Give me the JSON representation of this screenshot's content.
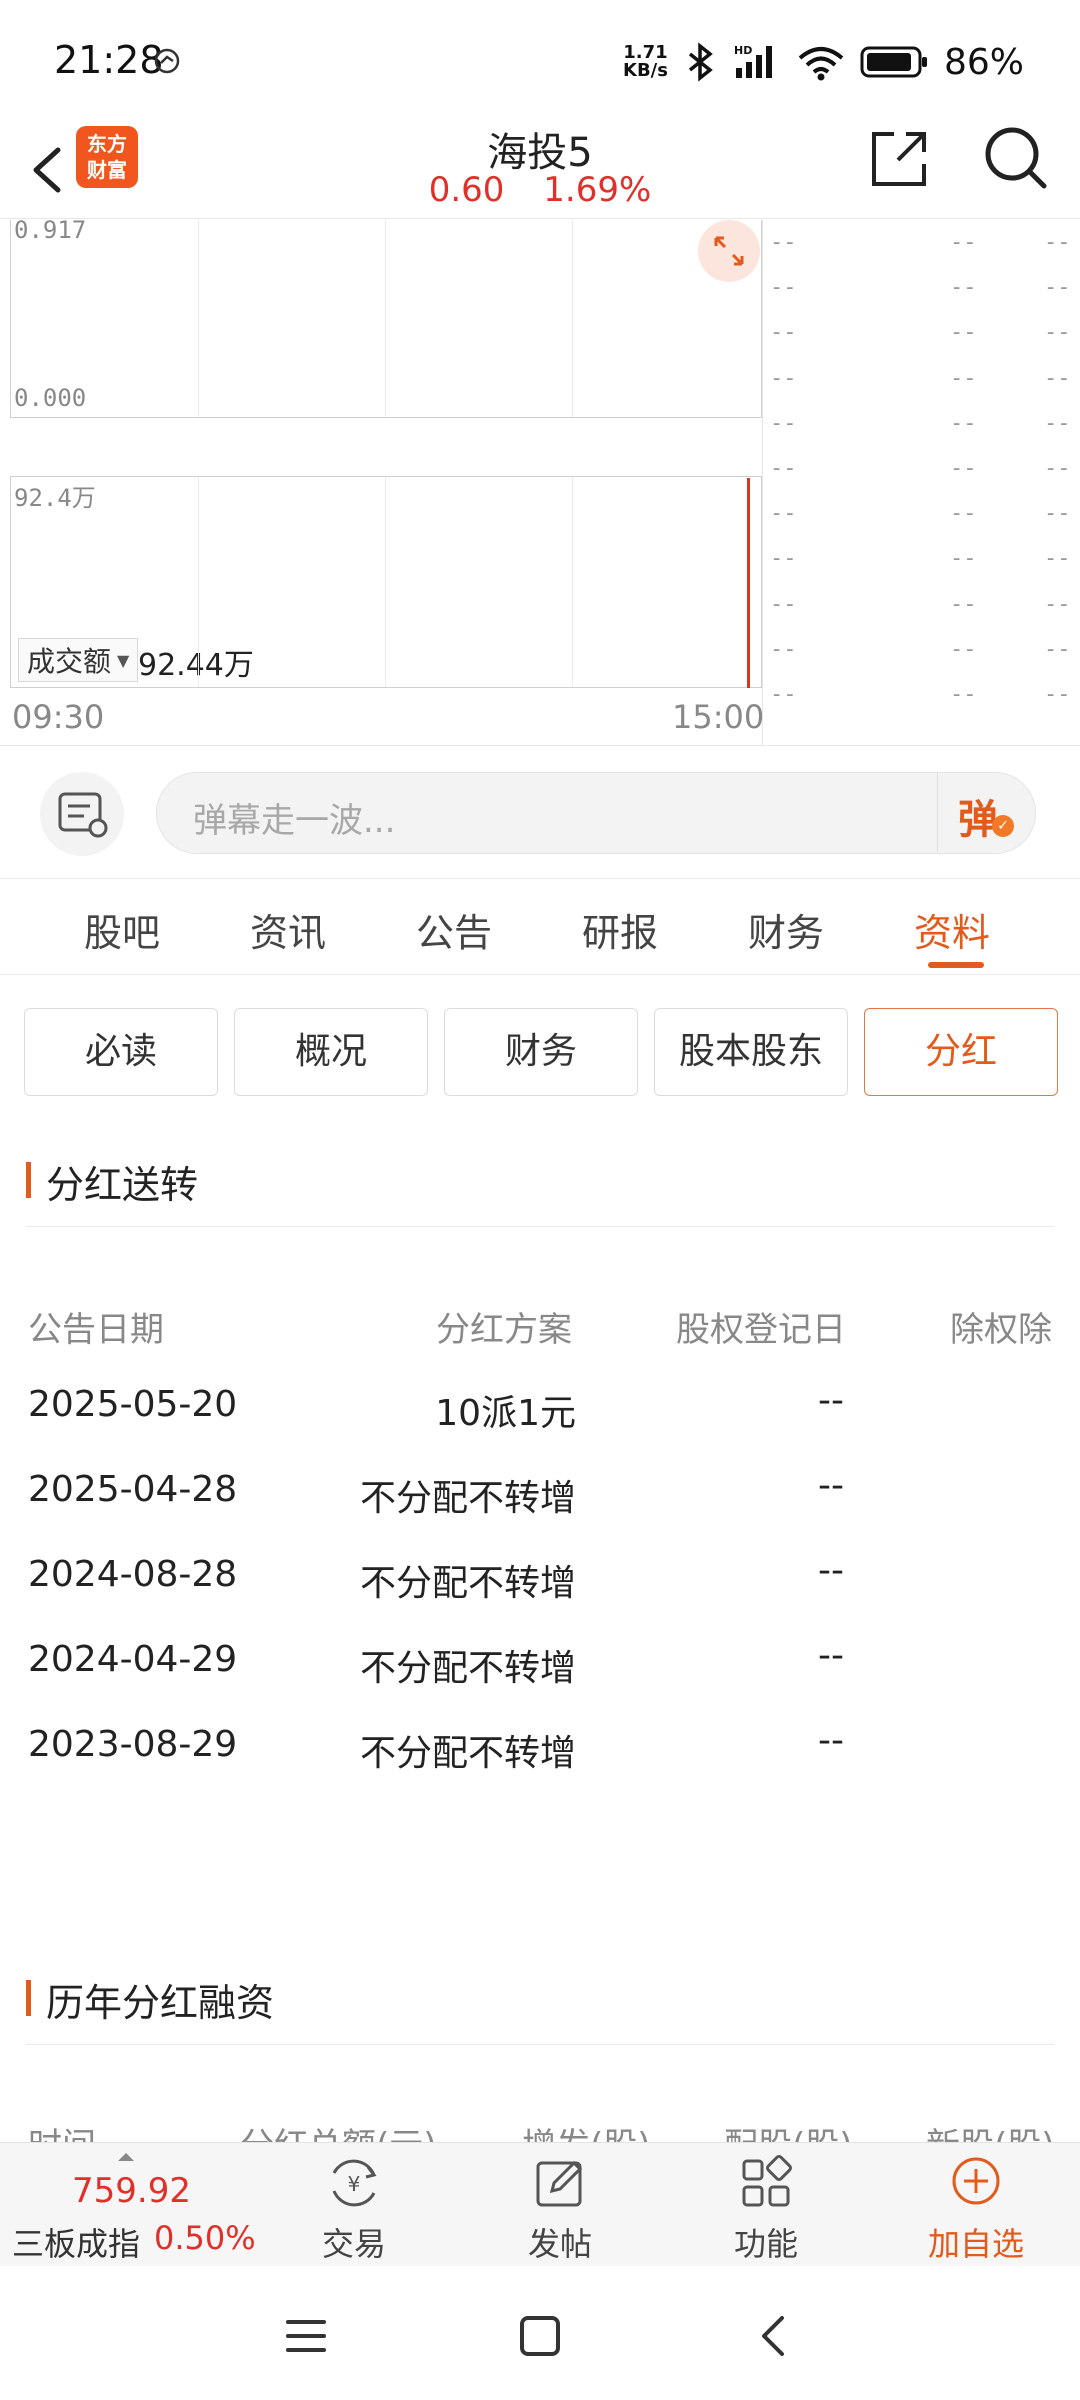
{
  "status_bar": {
    "time": "21:28",
    "net_speed_value": "1.71",
    "net_speed_unit": "KB/s",
    "signal_label": "HD",
    "battery": "86%"
  },
  "header": {
    "app_logo_line1": "东方",
    "app_logo_line2": "财富",
    "stock_name": "海投5",
    "price": "0.60",
    "change_pct": "1.69%"
  },
  "chart": {
    "price_axis_top": "0.917",
    "price_axis_bottom": "0.000",
    "volume_selector": "成交额",
    "volume_total": "92.44万",
    "volume_axis_top": "92.4万",
    "time_start": "09:30",
    "time_end": "15:00",
    "placeholder_cell": "--"
  },
  "comment": {
    "placeholder": "弹幕走一波...",
    "danmu_label": "弹"
  },
  "main_tabs": [
    {
      "label": "股吧"
    },
    {
      "label": "资讯"
    },
    {
      "label": "公告"
    },
    {
      "label": "研报"
    },
    {
      "label": "财务"
    },
    {
      "label": "资料"
    }
  ],
  "sub_tabs": [
    {
      "label": "必读"
    },
    {
      "label": "概况"
    },
    {
      "label": "财务"
    },
    {
      "label": "股本股东"
    },
    {
      "label": "分红"
    }
  ],
  "dividend": {
    "section_title": "分红送转",
    "headers": [
      "公告日期",
      "分红方案",
      "股权登记日",
      "除权除"
    ],
    "rows": [
      {
        "date": "2025-05-20",
        "plan": "10派1元",
        "record": "--"
      },
      {
        "date": "2025-04-28",
        "plan": "不分配不转增",
        "record": "--"
      },
      {
        "date": "2024-08-28",
        "plan": "不分配不转增",
        "record": "--"
      },
      {
        "date": "2024-04-29",
        "plan": "不分配不转增",
        "record": "--"
      },
      {
        "date": "2023-08-29",
        "plan": "不分配不转增",
        "record": "--"
      }
    ]
  },
  "history": {
    "section_title": "历年分红融资",
    "headers": [
      "时间",
      "分红总额(元)",
      "增发(股)",
      "配股(股)",
      "新股(股)"
    ]
  },
  "bottom_bar": {
    "index_value": "759.92",
    "index_name": "三板成指",
    "index_change": "0.50%",
    "items": [
      {
        "label": "交易",
        "icon": "yuan-exchange-icon"
      },
      {
        "label": "发帖",
        "icon": "edit-post-icon"
      },
      {
        "label": "功能",
        "icon": "grid-function-icon"
      },
      {
        "label": "加自选",
        "icon": "add-circle-icon"
      }
    ]
  },
  "colors": {
    "accent": "#e25a1c",
    "up_red": "#e0302a"
  }
}
